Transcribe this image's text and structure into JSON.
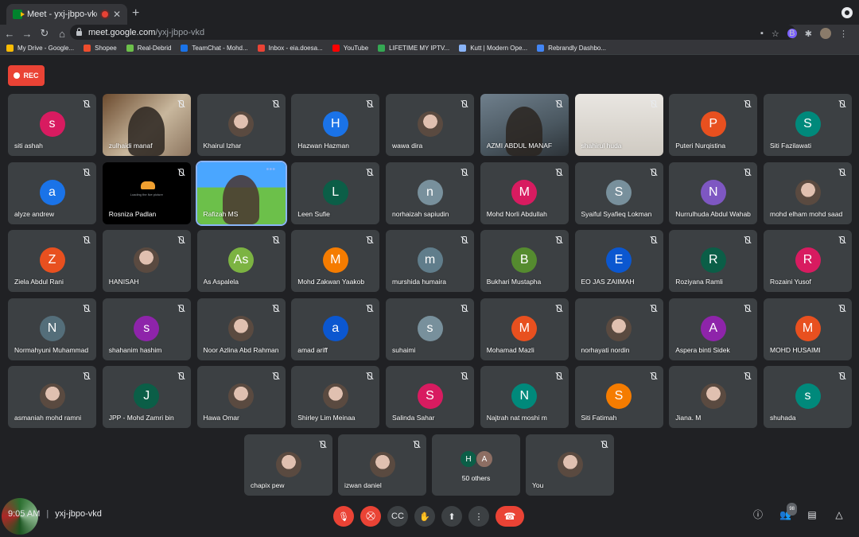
{
  "browser": {
    "tab_title": "Meet - yxj-jbpo-vkd",
    "tab_close": "✕",
    "new_tab": "+",
    "url_host": "meet.google.com",
    "url_path": "/yxj-jbpo-vkd",
    "bookmarks": [
      {
        "label": "My Drive - Google...",
        "color": "#fbbc04"
      },
      {
        "label": "Shopee",
        "color": "#ee4d2d"
      },
      {
        "label": "Real-Debrid",
        "color": "#6cc04a"
      },
      {
        "label": "TeamChat - Mohd...",
        "color": "#1a73e8"
      },
      {
        "label": "Inbox - eia.doesa...",
        "color": "#ea4335"
      },
      {
        "label": "YouTube",
        "color": "#ff0000"
      },
      {
        "label": "LIFETIME MY IPTV...",
        "color": "#34a853"
      },
      {
        "label": "Kutt | Modern Ope...",
        "color": "#8ab4f8"
      },
      {
        "label": "Rebrandly Dashbo...",
        "color": "#4285f4"
      }
    ]
  },
  "rec_label": "REC",
  "participants": [
    {
      "name": "siti ashah",
      "initial": "s",
      "color": "#d81b60"
    },
    {
      "name": "zulhaidi manaf",
      "video": "video-a"
    },
    {
      "name": "Khairul Izhar",
      "initial": "",
      "color": "#a0793d",
      "photo": true
    },
    {
      "name": "Hazwan Hazman",
      "initial": "H",
      "color": "#1a73e8"
    },
    {
      "name": "wawa dira",
      "initial": "",
      "color": "#7d5a6a",
      "photo": true
    },
    {
      "name": "AZMI ABDUL MANAF",
      "video": "video-b"
    },
    {
      "name": "shahirul huda",
      "video": "video-c"
    },
    {
      "name": "Puteri Nurqistina",
      "initial": "P",
      "color": "#e8501f"
    },
    {
      "name": "Siti Fazilawati",
      "initial": "S",
      "color": "#00897b"
    },
    {
      "name": "alyze andrew",
      "initial": "a",
      "color": "#1a73e8"
    },
    {
      "name": "Rosniza Padlan",
      "video": "video-d",
      "loading": "Loading the live picture"
    },
    {
      "name": "Rafizah MS",
      "video": "video-e",
      "active": true
    },
    {
      "name": "Leen Sufie",
      "initial": "L",
      "color": "#0b5e47"
    },
    {
      "name": "norhaizah sapiudin",
      "initial": "n",
      "color": "#78909c"
    },
    {
      "name": "Mohd Norli Abdullah",
      "initial": "M",
      "color": "#d81b60"
    },
    {
      "name": "Syaiful Syafieq Lokman",
      "initial": "S",
      "color": "#78909c"
    },
    {
      "name": "Nurrulhuda Abdul Wahab",
      "initial": "N",
      "color": "#7e57c2"
    },
    {
      "name": "mohd elham mohd saad",
      "initial": "",
      "color": "#8a7a6a",
      "photo": true
    },
    {
      "name": "Ziela Abdul Rani",
      "initial": "Z",
      "color": "#e8501f"
    },
    {
      "name": "HANISAH",
      "initial": "",
      "color": "#7a6a50",
      "photo": true
    },
    {
      "name": "As Aspalela",
      "initial": "As",
      "color": "#7cb342"
    },
    {
      "name": "Mohd Zakwan Yaakob",
      "initial": "M",
      "color": "#f57c00"
    },
    {
      "name": "murshida humaira",
      "initial": "m",
      "color": "#607d8b"
    },
    {
      "name": "Bukhari Mustapha",
      "initial": "B",
      "color": "#558b2f"
    },
    {
      "name": "EO JAS ZAIIMAH",
      "initial": "E",
      "color": "#0b57d0"
    },
    {
      "name": "Roziyana Ramli",
      "initial": "R",
      "color": "#0b5e47"
    },
    {
      "name": "Rozaini Yusof",
      "initial": "R",
      "color": "#d81b60"
    },
    {
      "name": "Normahyuni Muhammad",
      "initial": "N",
      "color": "#546e7a"
    },
    {
      "name": "shahanim hashim",
      "initial": "s",
      "color": "#8e24aa"
    },
    {
      "name": "Noor Azlina Abd Rahman",
      "initial": "",
      "color": "#2a6fb0",
      "photo": true
    },
    {
      "name": "amad ariff",
      "initial": "a",
      "color": "#0b57d0"
    },
    {
      "name": "suhaimi",
      "initial": "s",
      "color": "#78909c"
    },
    {
      "name": "Mohamad Mazli",
      "initial": "M",
      "color": "#e8501f"
    },
    {
      "name": "norhayati nordin",
      "initial": "",
      "color": "#d8c8b8",
      "photo": true
    },
    {
      "name": "Aspera binti Sidek",
      "initial": "A",
      "color": "#8e24aa"
    },
    {
      "name": "MOHD HUSAIMI",
      "initial": "M",
      "color": "#e8501f"
    },
    {
      "name": "asmaniah mohd ramni",
      "initial": "",
      "color": "#e8c0c0",
      "photo": true
    },
    {
      "name": "JPP - Mohd Zamri bin",
      "initial": "J",
      "color": "#0b5e47"
    },
    {
      "name": "Hawa Omar",
      "initial": "",
      "color": "#c87860",
      "photo": true
    },
    {
      "name": "Shirley Lim Meinaa",
      "initial": "",
      "color": "#6a3a3a",
      "photo": true
    },
    {
      "name": "Salinda Sahar",
      "initial": "S",
      "color": "#d81b60"
    },
    {
      "name": "Najtrah nat moshi m",
      "initial": "N",
      "color": "#00897b"
    },
    {
      "name": "Siti Fatimah",
      "initial": "S",
      "color": "#f57c00"
    },
    {
      "name": "Jiana. M",
      "initial": "",
      "color": "#a09a90",
      "photo": true
    },
    {
      "name": "shuhada",
      "initial": "s",
      "color": "#00897b"
    }
  ],
  "bottom_row": [
    {
      "name": "chapix pew",
      "photo": true
    },
    {
      "name": "izwan daniel",
      "photo": true
    },
    {
      "name": "50 others",
      "others": [
        {
          "initial": "H",
          "color": "#0b5e47"
        },
        {
          "initial": "A",
          "color": "#8d6e63"
        }
      ]
    },
    {
      "name": "You",
      "photo": true
    }
  ],
  "meeting": {
    "time": "9:05 AM",
    "separator": "|",
    "code": "yxj-jbpo-vkd",
    "participant_count": "98"
  }
}
